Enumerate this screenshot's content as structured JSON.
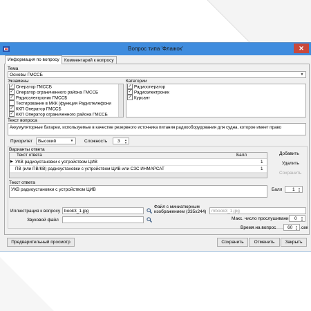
{
  "window": {
    "title": "Вопрос типа 'Флажок'",
    "close_label": "✕"
  },
  "tabs": [
    {
      "label": "Информация по вопросу",
      "active": true
    },
    {
      "label": "Комментарий к вопросу",
      "active": false
    }
  ],
  "theme": {
    "label": "Тема",
    "value": "Основы ГМССБ"
  },
  "exams": {
    "label": "Экзамены",
    "items": [
      {
        "label": "Оператор ГМССБ",
        "checked": true
      },
      {
        "label": "Оператор ограниченного района ГМССБ",
        "checked": true
      },
      {
        "label": "Радиоэлектроник ГМССБ",
        "checked": true
      },
      {
        "label": "Тестирование в МКК (функция Радиотелефони",
        "checked": false
      },
      {
        "label": "ККП Оператор ГМССБ",
        "checked": true
      },
      {
        "label": "ККП Оператор ограниченного района ГМССБ",
        "checked": true
      }
    ]
  },
  "categories": {
    "label": "Категории",
    "items": [
      {
        "label": "Радиооператор",
        "checked": true
      },
      {
        "label": "Радиоэлектроник",
        "checked": true
      },
      {
        "label": "Курсант",
        "checked": true
      }
    ]
  },
  "question": {
    "label": "Текст вопроса",
    "text": "Аккумуляторные батареи, используемые в качестве резервного источника питания радиооборудования для судна, которое имеет право"
  },
  "priority": {
    "label": "Приоритет",
    "value": "Высокий"
  },
  "difficulty": {
    "label": "Сложность",
    "value": "3"
  },
  "answers": {
    "label": "Варианты ответа",
    "col_text": "Текст ответа",
    "col_score": "Балл",
    "rows": [
      {
        "text": "УКВ радиоустановки с устройством ЦИВ",
        "score": "1",
        "selected": true
      },
      {
        "text": "ПВ (или ПВ/КВ) радиоустановки с устройством ЦИВ или СЗС ИНМАРСАТ",
        "score": "1",
        "selected": false
      }
    ],
    "add_label": "Добавить",
    "delete_label": "Удалить",
    "save_label": "Сохранить"
  },
  "answer_text": {
    "label": "Текст ответа",
    "value": "УКВ радиоустановки с устройством ЦИВ"
  },
  "answer_score": {
    "label": "Балл",
    "value": "1"
  },
  "illustration": {
    "label": "Иллюстрация к вопросу",
    "value": "book3_1.jpg"
  },
  "thumbnail": {
    "label": "Файл с миниатюрным изображением (335x244)",
    "value": "mbook3_1.jpg"
  },
  "sound": {
    "label": "Звуковой файл",
    "value": ""
  },
  "max_plays": {
    "label": "Макс. число прослушиваний",
    "value": "0"
  },
  "time": {
    "label": "Время на вопрос",
    "value": "60",
    "unit": "сек"
  },
  "footer": {
    "preview_label": "Предварительный просмотр",
    "save_label": "Сохранить",
    "cancel_label": "Отменить",
    "close_label": "Закрыть"
  },
  "colors": {
    "titlebar": "#3f8cde",
    "close": "#c9483b"
  }
}
